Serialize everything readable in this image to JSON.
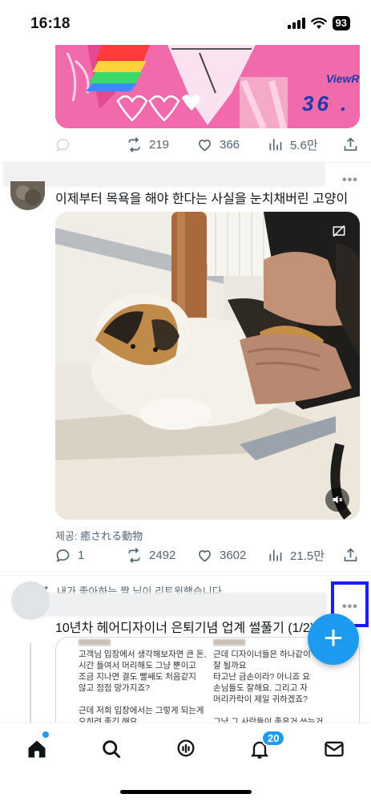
{
  "status_bar": {
    "time": "16:18",
    "battery": "93"
  },
  "colors": {
    "accent": "#1d9bf0",
    "text": "#0f1419",
    "muted": "#536471",
    "highlight_box": "#1a1aff"
  },
  "posts": [
    {
      "media_overlay_text": [
        "ViewR",
        "36 ."
      ],
      "actions": {
        "reply": "",
        "retweets": "219",
        "likes": "366",
        "views": "5.6만"
      }
    },
    {
      "text": "이제부터 목욕을 해야 한다는 사실을 눈치채버린 고양이",
      "credit": "제공: 癒される動物",
      "actions": {
        "reply": "1",
        "retweets": "2492",
        "likes": "3602",
        "views": "21.5만"
      }
    },
    {
      "retweet_context": "내가 좋아하는 짤 님이 리트윗했습니다",
      "text": "10년차 헤어디자이너 은퇴기념 업계 썰풀기 (1/2)",
      "card_left": "고객님 입장에서 생각해보자면 큰 돈,\n시간 들여서 머리해도 그냥 뿐이고\n조금 지나면 결도 빨쌔도 처음같지\n않고 점점 망가지죠?\n\n근데 저희 입장에서는 그렇게 되는게\n오히려 좋긴 해요.\n'계속 찾아주시니까'",
      "card_right": "근데 디자이너들은 하나같이 머리가\n잘 될까요\n타고난 금손이라? 아니죠 요\n손님들도 잘해요. 그리고 자\n머리카락이 제일 귀하겠죠?\n\n그냥 그 사람들이 좋은거 쓰는거\n뿐이에요"
    }
  ],
  "tab_bar": {
    "items": [
      "home-icon",
      "search-icon",
      "spaces-icon",
      "notifications-icon",
      "messages-icon"
    ],
    "notification_count": "20"
  },
  "fab_label": "+"
}
